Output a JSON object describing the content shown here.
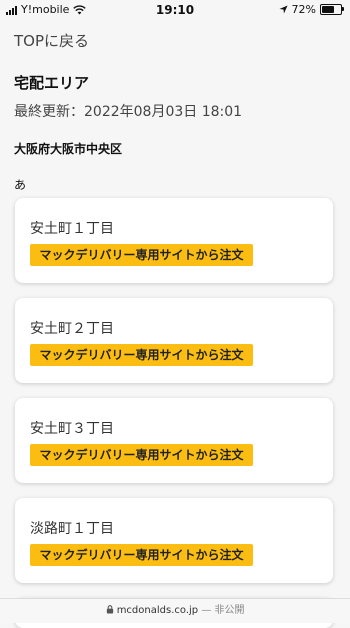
{
  "status_bar": {
    "carrier": "Y!mobile",
    "time": "19:10",
    "battery": "72%",
    "battery_level": 0.72
  },
  "nav": {
    "top_link": "TOPに戻る"
  },
  "page": {
    "title": "宅配エリア",
    "updated": "最終更新：2022年08月03日 18:01",
    "district": "大阪府大阪市中央区",
    "kana_heading": "あ"
  },
  "areas": [
    {
      "name": "安土町１丁目",
      "button": "マックデリバリー専用サイトから注文"
    },
    {
      "name": "安土町２丁目",
      "button": "マックデリバリー専用サイトから注文"
    },
    {
      "name": "安土町３丁目",
      "button": "マックデリバリー専用サイトから注文"
    },
    {
      "name": "淡路町１丁目",
      "button": "マックデリバリー専用サイトから注文"
    }
  ],
  "url_bar": {
    "domain": "mcdonalds.co.jp",
    "privacy": "— 非公開"
  },
  "colors": {
    "accent": "#fbbd12",
    "background": "#f6f6f6"
  }
}
